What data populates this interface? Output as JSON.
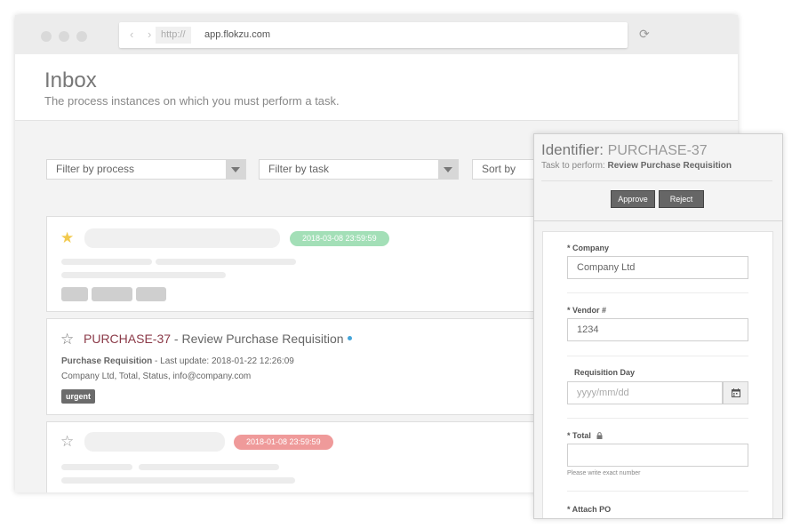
{
  "browser": {
    "nav_arrows": "‹ ›",
    "protocol": "http://",
    "url": "app.flokzu.com",
    "reload_glyph": "⟳"
  },
  "page": {
    "title": "Inbox",
    "subtitle": "The process instances on which you must perform a task."
  },
  "filters": {
    "process": "Filter by process",
    "task": "Filter by task",
    "sort": "Sort by"
  },
  "cards": [
    {
      "date": "2018-03-08 23:59:59",
      "date_color": "#a3dfb7",
      "starred": true
    },
    {
      "id": "PURCHASE-37",
      "separator": " - ",
      "task": "Review Purchase Requisition",
      "process": "Purchase Requisition",
      "update_text": " - Last update: 2018-01-22 12:26:09",
      "fields": "Company Ltd, Total, Status, info@company.com",
      "tag": "urgent",
      "starred": false
    },
    {
      "date": "2018-01-08 23:59:59",
      "date_color": "#ef9a9a",
      "starred": false
    }
  ],
  "panel": {
    "identifier_label": "Identifier: ",
    "identifier_value": "PURCHASE-37",
    "task_label": "Task to perform: ",
    "task_value": "Review Purchase Requisition",
    "approve_label": "Approve",
    "reject_label": "Reject",
    "fields": {
      "company_label": "* Company",
      "company_value": "Company Ltd",
      "vendor_label": "* Vendor #",
      "vendor_value": "1234",
      "day_label": "Requisition Day",
      "day_placeholder": "yyyy/mm/dd",
      "total_label": "* Total",
      "total_hint": "Please write exact number",
      "attach_label": "* Attach PO"
    }
  },
  "icons": {
    "star_filled": "star-filled-icon",
    "star_empty": "star-outline-icon",
    "calendar": "calendar-icon",
    "lock": "lock-icon",
    "reload": "reload-icon"
  },
  "colors": {
    "accent_id": "#8b3a48",
    "star_gold": "#f2c94c",
    "status_dot": "#45a5d9",
    "button_dark": "#666666"
  }
}
